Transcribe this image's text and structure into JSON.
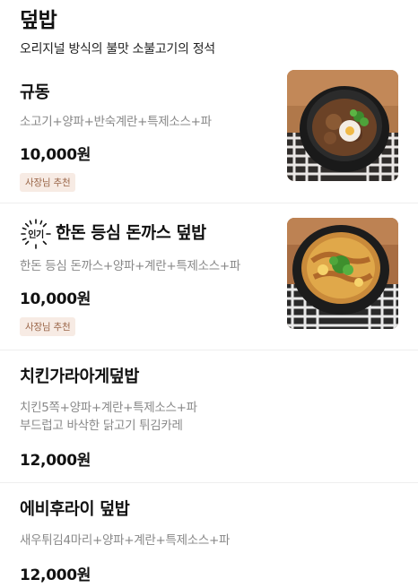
{
  "category": {
    "title": "덮밥",
    "description": "오리지널 방식의 불맛 소불고기의 정석"
  },
  "items": [
    {
      "name": "규동",
      "components": "소고기+양파+반숙계란+특제소스+파",
      "price": "10,000원",
      "badge": "사장님 추천"
    },
    {
      "popular_label": "인기",
      "name": "한돈 등심 돈까스 덮밥",
      "components": "한돈 등심 돈까스+양파+계란+특제소스+파",
      "price": "10,000원",
      "badge": "사장님 추천"
    },
    {
      "name": "치킨가라아게덮밥",
      "components": "치킨5쪽+양파+계란+특제소스+파",
      "description": "부드럽고 바삭한 닭고기 튀김카레",
      "price": "12,000원"
    },
    {
      "name": "에비후라이 덮밥",
      "components": "새우튀김4마리+양파+계란+특제소스+파",
      "price": "12,000원"
    }
  ],
  "colors": {
    "badge_bg": "#f7ebe4",
    "badge_text": "#9a6547",
    "muted_text": "#888888"
  }
}
